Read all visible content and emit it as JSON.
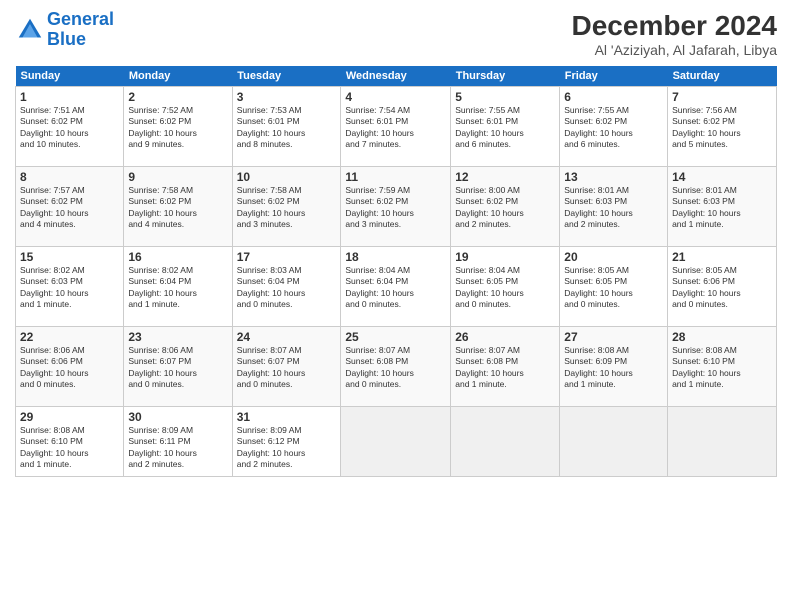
{
  "header": {
    "logo_line1": "General",
    "logo_line2": "Blue",
    "month": "December 2024",
    "location": "Al 'Aziziyah, Al Jafarah, Libya"
  },
  "days_of_week": [
    "Sunday",
    "Monday",
    "Tuesday",
    "Wednesday",
    "Thursday",
    "Friday",
    "Saturday"
  ],
  "weeks": [
    [
      {
        "day": 1,
        "info": "Sunrise: 7:51 AM\nSunset: 6:02 PM\nDaylight: 10 hours\nand 10 minutes."
      },
      {
        "day": 2,
        "info": "Sunrise: 7:52 AM\nSunset: 6:02 PM\nDaylight: 10 hours\nand 9 minutes."
      },
      {
        "day": 3,
        "info": "Sunrise: 7:53 AM\nSunset: 6:01 PM\nDaylight: 10 hours\nand 8 minutes."
      },
      {
        "day": 4,
        "info": "Sunrise: 7:54 AM\nSunset: 6:01 PM\nDaylight: 10 hours\nand 7 minutes."
      },
      {
        "day": 5,
        "info": "Sunrise: 7:55 AM\nSunset: 6:01 PM\nDaylight: 10 hours\nand 6 minutes."
      },
      {
        "day": 6,
        "info": "Sunrise: 7:55 AM\nSunset: 6:02 PM\nDaylight: 10 hours\nand 6 minutes."
      },
      {
        "day": 7,
        "info": "Sunrise: 7:56 AM\nSunset: 6:02 PM\nDaylight: 10 hours\nand 5 minutes."
      }
    ],
    [
      {
        "day": 8,
        "info": "Sunrise: 7:57 AM\nSunset: 6:02 PM\nDaylight: 10 hours\nand 4 minutes."
      },
      {
        "day": 9,
        "info": "Sunrise: 7:58 AM\nSunset: 6:02 PM\nDaylight: 10 hours\nand 4 minutes."
      },
      {
        "day": 10,
        "info": "Sunrise: 7:58 AM\nSunset: 6:02 PM\nDaylight: 10 hours\nand 3 minutes."
      },
      {
        "day": 11,
        "info": "Sunrise: 7:59 AM\nSunset: 6:02 PM\nDaylight: 10 hours\nand 3 minutes."
      },
      {
        "day": 12,
        "info": "Sunrise: 8:00 AM\nSunset: 6:02 PM\nDaylight: 10 hours\nand 2 minutes."
      },
      {
        "day": 13,
        "info": "Sunrise: 8:01 AM\nSunset: 6:03 PM\nDaylight: 10 hours\nand 2 minutes."
      },
      {
        "day": 14,
        "info": "Sunrise: 8:01 AM\nSunset: 6:03 PM\nDaylight: 10 hours\nand 1 minute."
      }
    ],
    [
      {
        "day": 15,
        "info": "Sunrise: 8:02 AM\nSunset: 6:03 PM\nDaylight: 10 hours\nand 1 minute."
      },
      {
        "day": 16,
        "info": "Sunrise: 8:02 AM\nSunset: 6:04 PM\nDaylight: 10 hours\nand 1 minute."
      },
      {
        "day": 17,
        "info": "Sunrise: 8:03 AM\nSunset: 6:04 PM\nDaylight: 10 hours\nand 0 minutes."
      },
      {
        "day": 18,
        "info": "Sunrise: 8:04 AM\nSunset: 6:04 PM\nDaylight: 10 hours\nand 0 minutes."
      },
      {
        "day": 19,
        "info": "Sunrise: 8:04 AM\nSunset: 6:05 PM\nDaylight: 10 hours\nand 0 minutes."
      },
      {
        "day": 20,
        "info": "Sunrise: 8:05 AM\nSunset: 6:05 PM\nDaylight: 10 hours\nand 0 minutes."
      },
      {
        "day": 21,
        "info": "Sunrise: 8:05 AM\nSunset: 6:06 PM\nDaylight: 10 hours\nand 0 minutes."
      }
    ],
    [
      {
        "day": 22,
        "info": "Sunrise: 8:06 AM\nSunset: 6:06 PM\nDaylight: 10 hours\nand 0 minutes."
      },
      {
        "day": 23,
        "info": "Sunrise: 8:06 AM\nSunset: 6:07 PM\nDaylight: 10 hours\nand 0 minutes."
      },
      {
        "day": 24,
        "info": "Sunrise: 8:07 AM\nSunset: 6:07 PM\nDaylight: 10 hours\nand 0 minutes."
      },
      {
        "day": 25,
        "info": "Sunrise: 8:07 AM\nSunset: 6:08 PM\nDaylight: 10 hours\nand 0 minutes."
      },
      {
        "day": 26,
        "info": "Sunrise: 8:07 AM\nSunset: 6:08 PM\nDaylight: 10 hours\nand 1 minute."
      },
      {
        "day": 27,
        "info": "Sunrise: 8:08 AM\nSunset: 6:09 PM\nDaylight: 10 hours\nand 1 minute."
      },
      {
        "day": 28,
        "info": "Sunrise: 8:08 AM\nSunset: 6:10 PM\nDaylight: 10 hours\nand 1 minute."
      }
    ],
    [
      {
        "day": 29,
        "info": "Sunrise: 8:08 AM\nSunset: 6:10 PM\nDaylight: 10 hours\nand 1 minute."
      },
      {
        "day": 30,
        "info": "Sunrise: 8:09 AM\nSunset: 6:11 PM\nDaylight: 10 hours\nand 2 minutes."
      },
      {
        "day": 31,
        "info": "Sunrise: 8:09 AM\nSunset: 6:12 PM\nDaylight: 10 hours\nand 2 minutes."
      },
      null,
      null,
      null,
      null
    ]
  ]
}
